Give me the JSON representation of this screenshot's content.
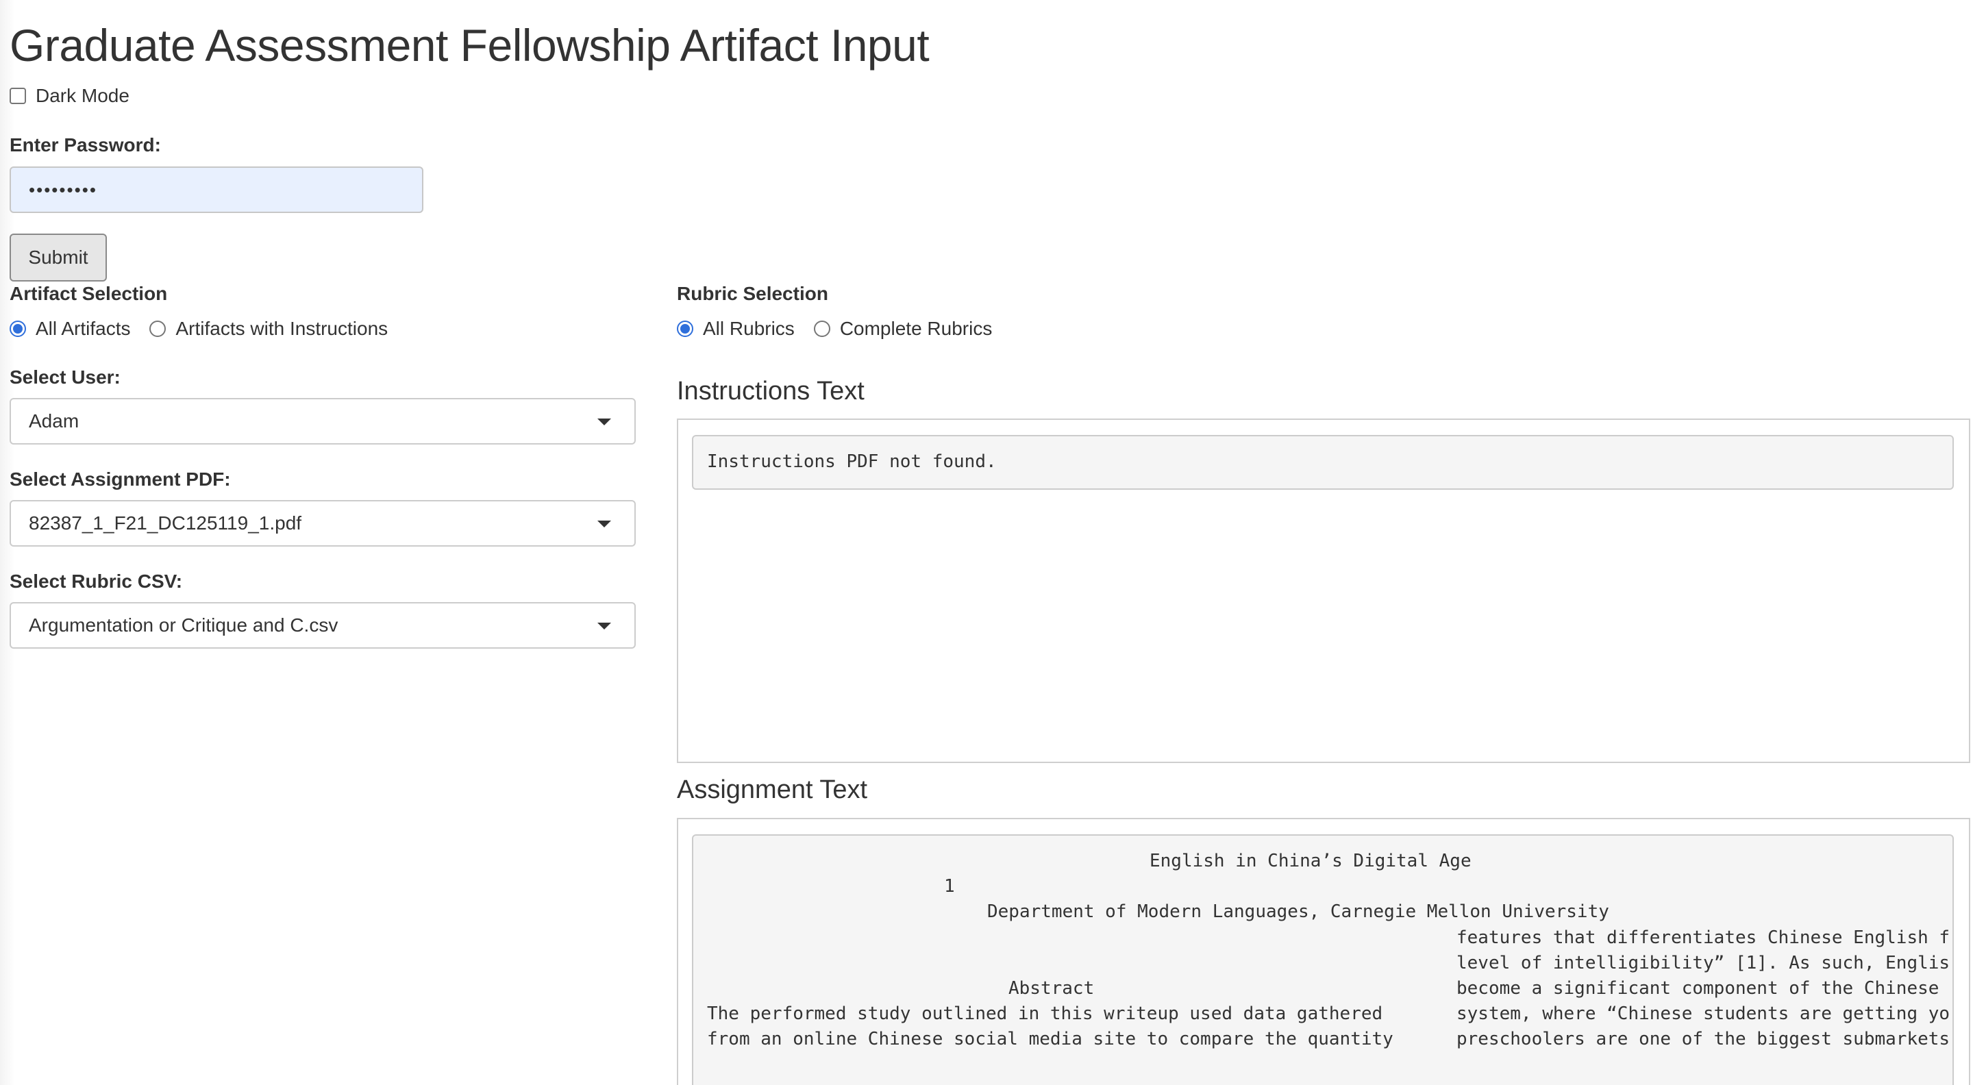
{
  "header": {
    "title": "Graduate Assessment Fellowship Artifact Input"
  },
  "dark_mode": {
    "label": "Dark Mode",
    "checked": false
  },
  "password": {
    "label": "Enter Password:",
    "masked_value": "•••••••••"
  },
  "submit": {
    "label": "Submit"
  },
  "artifact_selection": {
    "label": "Artifact Selection",
    "options": [
      "All Artifacts",
      "Artifacts with Instructions"
    ],
    "selected": "All Artifacts"
  },
  "rubric_selection": {
    "label": "Rubric Selection",
    "options": [
      "All Rubrics",
      "Complete Rubrics"
    ],
    "selected": "All Rubrics"
  },
  "select_user": {
    "label": "Select User:",
    "value": "Adam"
  },
  "select_assignment": {
    "label": "Select Assignment PDF:",
    "value": "82387_1_F21_DC125119_1.pdf"
  },
  "select_rubric": {
    "label": "Select Rubric CSV:",
    "value": "Argumentation or Critique and C.csv"
  },
  "instructions": {
    "heading": "Instructions Text",
    "text": "Instructions PDF not found."
  },
  "assignment": {
    "heading": "Assignment Text",
    "lines": {
      "title": "English in China’s Digital Age",
      "superscript": "1",
      "affiliation": "Department of Modern Languages, Carnegie Mellon University",
      "abstract_heading": "Abstract",
      "col1_line1": "The performed study outlined in this writeup used data gathered",
      "col1_line2": "from an online Chinese social media site to compare the quantity",
      "col2_line1": "features that differentiates Chinese English f",
      "col2_line2": "level of intelligibility” [1]. As such, Englis",
      "col2_line3": "become a significant component of the Chinese",
      "col2_line4": "system, where “Chinese students are getting yo",
      "col2_line5": "preschoolers are one of the biggest submarkets"
    }
  }
}
